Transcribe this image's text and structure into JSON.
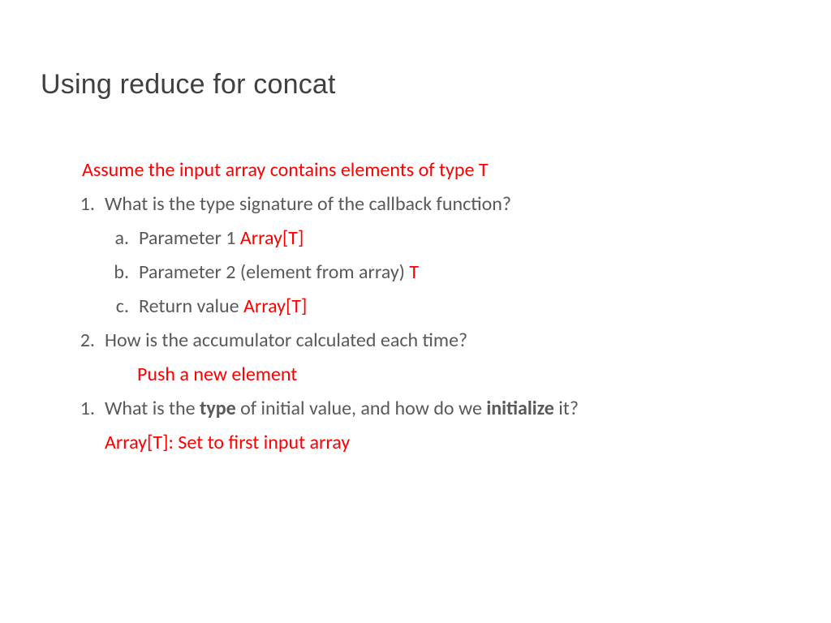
{
  "title": "Using reduce for concat",
  "intro": "Assume the input array contains elements of type T",
  "q1": {
    "num": "1.",
    "text": "What is the type signature of the callback function?",
    "a": {
      "letter": "a.",
      "label": "Parameter 1 ",
      "ans": "Array[T]"
    },
    "b": {
      "letter": "b.",
      "label": "Parameter 2 (element from array) ",
      "ans": "T"
    },
    "c": {
      "letter": "c.",
      "label": "Return value ",
      "ans": "Array[T]"
    }
  },
  "q2": {
    "num": "2.",
    "text": "How is the accumulator calculated each time?",
    "ans": "Push a new element"
  },
  "q3": {
    "num": "1.",
    "pre": "What is the ",
    "bold1": "type",
    "mid": " of initial value, and how do we ",
    "bold2": "initialize",
    "post": " it?",
    "ans": "Array[T]: Set to first input array"
  }
}
